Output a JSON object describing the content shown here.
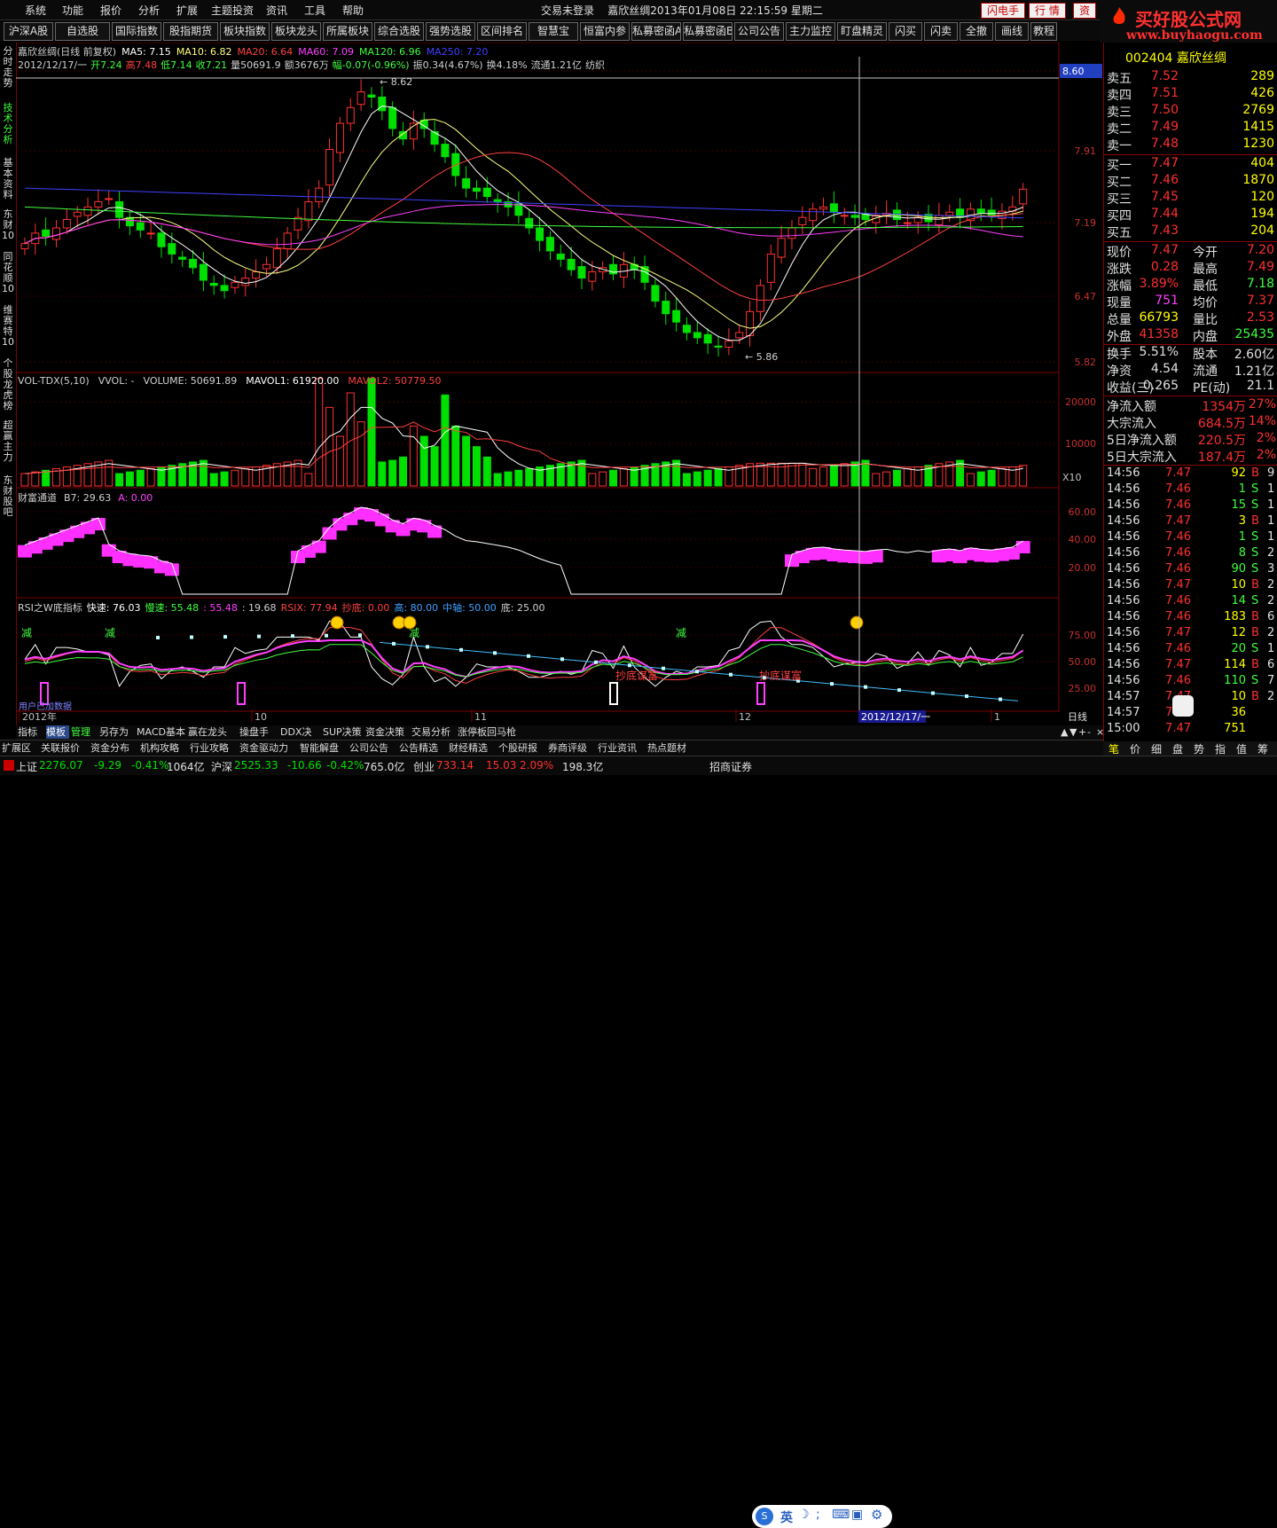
{
  "menu": {
    "items": [
      "系统",
      "功能",
      "报价",
      "分析",
      "扩展",
      "主题投资",
      "资讯",
      "工具",
      "帮助"
    ],
    "status": "交易未登录",
    "stock_title": "嘉欣丝绸2013年01月08日 22:15:59 星期二",
    "btn_flash": "闪电手",
    "btn_quote": "行 情",
    "btn_data": "资"
  },
  "logo": {
    "line1": "买好股公式网",
    "line2": "www.buyhaogu.com"
  },
  "toolbar": [
    "沪深A股",
    "自选股",
    "国际指数",
    "股指期货",
    "板块指数",
    "板块龙头",
    "所属板块",
    "综合选股",
    "强势选股",
    "区间排名",
    "智慧宝",
    "恒富内参",
    "私募密函A",
    "私募密函B",
    "公司公告",
    "主力监控",
    "盯盘精灵",
    "闪买",
    "闪卖",
    "全撤",
    "画线",
    "教程"
  ],
  "lefttabs": [
    "分时走势",
    "技术分析",
    "基本资料",
    "东财10",
    "同花顺10",
    "维赛特10",
    "个股龙虎榜",
    "超赢主力",
    "东财股吧"
  ],
  "chart": {
    "header1": [
      {
        "t": "嘉欣丝绸(日线 前复权)",
        "c": "#d0d0d0"
      },
      {
        "t": "MA5: 7.15",
        "c": "#ffffff"
      },
      {
        "t": "MA10: 6.82",
        "c": "#ffff80"
      },
      {
        "t": "MA20: 6.64",
        "c": "#ff4040"
      },
      {
        "t": "MA60: 7.09",
        "c": "#ff40ff"
      },
      {
        "t": "MA120: 6.96",
        "c": "#40ff40"
      },
      {
        "t": "MA250: 7.20",
        "c": "#4040ff"
      }
    ],
    "header2": [
      {
        "t": "2012/12/17/一",
        "c": "#d0d0d0"
      },
      {
        "t": "开7.24",
        "c": "#40ff40"
      },
      {
        "t": "高7.48",
        "c": "#ff4040"
      },
      {
        "t": "低7.14",
        "c": "#40ff40"
      },
      {
        "t": "收7.21",
        "c": "#40ff40"
      },
      {
        "t": "量50691.9",
        "c": "#d0d0d0"
      },
      {
        "t": "额3676万",
        "c": "#d0d0d0"
      },
      {
        "t": "幅-0.07(-0.96%)",
        "c": "#40ff40"
      },
      {
        "t": "振0.34(4.67%)",
        "c": "#d0d0d0"
      },
      {
        "t": "换4.18%",
        "c": "#d0d0d0"
      },
      {
        "t": "流通1.21亿",
        "c": "#d0d0d0"
      },
      {
        "t": "纺织",
        "c": "#d0d0d0"
      }
    ],
    "price_axis": [
      "8.60",
      "7.91",
      "7.19",
      "6.47",
      "5.82"
    ],
    "high_mark": "8.62",
    "low_mark": "5.86",
    "vol_header": [
      {
        "t": "VOL-TDX(5,10)",
        "c": "#d0d0d0"
      },
      {
        "t": "VVOL: -",
        "c": "#d0d0d0"
      },
      {
        "t": "VOLUME: 50691.89",
        "c": "#d0d0d0"
      },
      {
        "t": "MAVOL1: 61920.00",
        "c": "#ffffff"
      },
      {
        "t": "MAVOL2: 50779.50",
        "c": "#ff4040"
      }
    ],
    "vol_axis": [
      "20000",
      "10000"
    ],
    "vol_unit": "X10",
    "cf_header": [
      {
        "t": "财富通道",
        "c": "#d0d0d0"
      },
      {
        "t": "B7: 29.63",
        "c": "#d0d0d0"
      },
      {
        "t": "A: 0.00",
        "c": "#ff40ff"
      }
    ],
    "cf_axis": [
      "60.00",
      "40.00",
      "20.00"
    ],
    "rsi_header": [
      {
        "t": "RSI之W底指标",
        "c": "#d0d0d0"
      },
      {
        "t": "快速: 76.03",
        "c": "#ffffff"
      },
      {
        "t": "慢速: 55.48",
        "c": "#40ff40"
      },
      {
        "t": ": 55.48",
        "c": "#ff40ff"
      },
      {
        "t": ": 19.68",
        "c": "#d0d0d0"
      },
      {
        "t": "RSIX: 77.94",
        "c": "#ff4040"
      },
      {
        "t": "抄底: 0.00",
        "c": "#ff4040"
      },
      {
        "t": "高: 80.00",
        "c": "#40a0ff"
      },
      {
        "t": "中轴: 50.00",
        "c": "#40a0ff"
      },
      {
        "t": "底: 25.00",
        "c": "#d0d0d0"
      }
    ],
    "rsi_axis": [
      "75.00",
      "50.00",
      "25.00"
    ],
    "rsi_labels": [
      "减",
      "减",
      "减",
      "减",
      "抄底谋富",
      "抄底谋富"
    ],
    "watermark": "用户已加数据",
    "x_dates": [
      "2012年",
      "10",
      "11",
      "12",
      "2012/12/17/一",
      "1"
    ],
    "period": "日线"
  },
  "rpanel": {
    "code": "002404",
    "name": "嘉欣丝绸",
    "asks": [
      [
        "卖五",
        "7.52",
        "289"
      ],
      [
        "卖四",
        "7.51",
        "426"
      ],
      [
        "卖三",
        "7.50",
        "2769"
      ],
      [
        "卖二",
        "7.49",
        "1415"
      ],
      [
        "卖一",
        "7.48",
        "1230"
      ]
    ],
    "bids": [
      [
        "买一",
        "7.47",
        "404"
      ],
      [
        "买二",
        "7.46",
        "1870"
      ],
      [
        "买三",
        "7.45",
        "120"
      ],
      [
        "买四",
        "7.44",
        "194"
      ],
      [
        "买五",
        "7.43",
        "204"
      ]
    ],
    "stats": [
      [
        "现价",
        "7.47",
        "今开",
        "7.20"
      ],
      [
        "涨跌",
        "0.28",
        "最高",
        "7.49"
      ],
      [
        "涨幅",
        "3.89%",
        "最低",
        "7.18"
      ],
      [
        "现量",
        "751",
        "均价",
        "7.37"
      ],
      [
        "总量",
        "66793",
        "量比",
        "2.53"
      ],
      [
        "外盘",
        "41358",
        "内盘",
        "25435"
      ]
    ],
    "stats2": [
      [
        "换手",
        "5.51%",
        "股本",
        "2.60亿"
      ],
      [
        "净资",
        "4.54",
        "流通",
        "1.21亿"
      ],
      [
        "收益(三)",
        "0.265",
        "PE(动)",
        "21.1"
      ]
    ],
    "flows": [
      [
        "净流入额",
        "1354万",
        "27%"
      ],
      [
        "大宗流入",
        "684.5万",
        "14%"
      ],
      [
        "5日净流入额",
        "220.5万",
        "2%"
      ],
      [
        "5日大宗流入",
        "187.4万",
        "2%"
      ]
    ],
    "ticks": [
      [
        "14:56",
        "7.47",
        "92",
        "B",
        "9"
      ],
      [
        "14:56",
        "7.46",
        "1",
        "S",
        "1"
      ],
      [
        "14:56",
        "7.46",
        "15",
        "S",
        "1"
      ],
      [
        "14:56",
        "7.47",
        "3",
        "B",
        "1"
      ],
      [
        "14:56",
        "7.46",
        "1",
        "S",
        "1"
      ],
      [
        "14:56",
        "7.46",
        "8",
        "S",
        "2"
      ],
      [
        "14:56",
        "7.46",
        "90",
        "S",
        "3"
      ],
      [
        "14:56",
        "7.47",
        "10",
        "B",
        "2"
      ],
      [
        "14:56",
        "7.46",
        "14",
        "S",
        "2"
      ],
      [
        "14:56",
        "7.46",
        "183",
        "B",
        "6"
      ],
      [
        "14:56",
        "7.47",
        "12",
        "B",
        "2"
      ],
      [
        "14:56",
        "7.46",
        "20",
        "S",
        "1"
      ],
      [
        "14:56",
        "7.47",
        "114",
        "B",
        "6"
      ],
      [
        "14:56",
        "7.46",
        "110",
        "S",
        "7"
      ],
      [
        "14:57",
        "7.47",
        "10",
        "B",
        "2"
      ],
      [
        "14:57",
        "7.47",
        "36",
        "",
        ""
      ],
      [
        "15:00",
        "7.47",
        "751",
        "",
        ""
      ]
    ],
    "bottom_tabs": [
      "笔",
      "价",
      "细",
      "盘",
      "势",
      "指",
      "值",
      "筹"
    ]
  },
  "bottomtabs": [
    "指标",
    "模板",
    "管理",
    "另存为",
    "MACD基本",
    "赢在龙头",
    "操盘手",
    "DDX决策",
    "SUP决策",
    "资金决策",
    "交易分析",
    "涨停板回马枪"
  ],
  "bottom2": [
    "扩展区",
    "关联报价",
    "资金分布",
    "机构攻略",
    "行业攻略",
    "资金驱动力",
    "智能解盘",
    "公司公告",
    "公告精选",
    "财经精选",
    "个股研报",
    "券商评级",
    "行业资讯",
    "热点题材"
  ],
  "status": {
    "sh_label": "上证",
    "sh_val": "2276.07",
    "sh_chg": "-9.29",
    "sh_pct": "-0.41%",
    "sh_amt": "1064亿",
    "sz_label": "沪深",
    "sz_val": "2525.33",
    "sz_chg": "-10.66",
    "sz_pct": "-0.42%",
    "sz_amt": "765.0亿",
    "cy_label": "创业",
    "cy_val": "733.14",
    "cy_chg": "15.03",
    "cy_pct": "2.09%",
    "cy_amt": "198.3亿",
    "broker": "招商证券",
    "ime": "英"
  },
  "colors": {
    "up": "#ff3030",
    "down": "#00e000",
    "bg": "#000000",
    "grid": "#5a0000"
  }
}
